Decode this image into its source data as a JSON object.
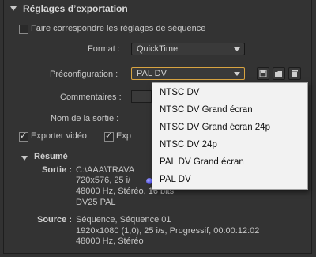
{
  "header": {
    "title": "Réglages d’exportation"
  },
  "match_sequence": {
    "label": "Faire correspondre les réglages de séquence",
    "checked": false
  },
  "format": {
    "label": "Format :",
    "value": "QuickTime"
  },
  "preset": {
    "label": "Préconfiguration :",
    "value": "PAL DV"
  },
  "comments": {
    "label": "Commentaires :"
  },
  "output_name": {
    "label": "Nom de la sortie :"
  },
  "export_video": {
    "label": "Exporter vidéo",
    "checked": true
  },
  "export_audio": {
    "label": "Exp",
    "checked": true
  },
  "dropdown": {
    "options": [
      "NTSC DV",
      "NTSC DV Grand écran",
      "NTSC DV Grand écran 24p",
      "NTSC DV 24p",
      "PAL DV Grand écran",
      "PAL DV"
    ],
    "selected_index": 5
  },
  "summary": {
    "title": "Résumé",
    "output_label": "Sortie :",
    "output_lines": [
      "C:\\AAA\\TRAVA",
      "720x576, 25 i/",
      "48000 Hz, Stéréo, 16 bits",
      "DV25 PAL"
    ],
    "source_label": "Source :",
    "source_lines": [
      "Séquence, Séquence 01",
      "1920x1080 (1,0), 25 i/s, Progressif, 00:00:12:02",
      "48000 Hz, Stéréo"
    ]
  }
}
